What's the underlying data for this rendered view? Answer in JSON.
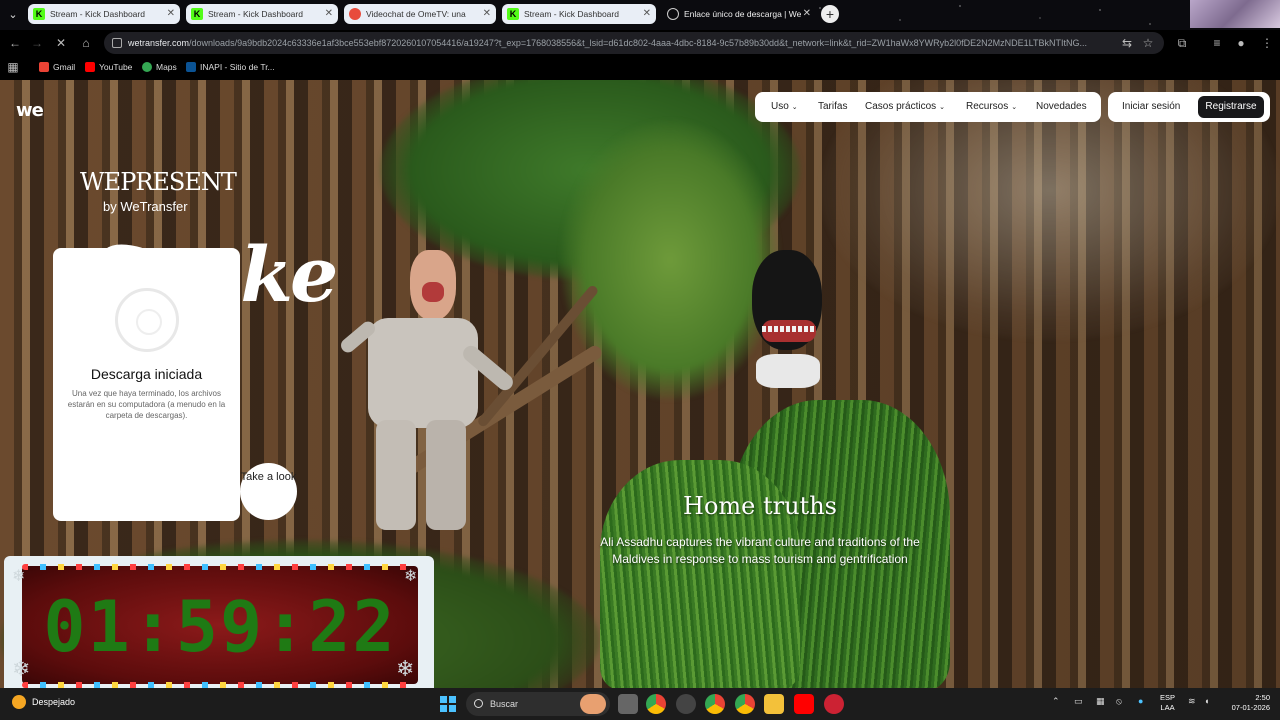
{
  "browser": {
    "tabs": [
      {
        "label": "Stream - Kick Dashboard",
        "favicon": "kick-icon",
        "active": false
      },
      {
        "label": "Stream - Kick Dashboard",
        "favicon": "kick-icon",
        "active": false
      },
      {
        "label": "Videochat de OmeTV: una",
        "favicon": "ometv-icon",
        "active": false
      },
      {
        "label": "Stream - Kick Dashboard",
        "favicon": "kick-icon",
        "active": false
      },
      {
        "label": "Enlace único de descarga | We",
        "favicon": "loading-icon",
        "active": true
      }
    ],
    "url_host": "wetransfer.com",
    "url_path": "/downloads/9a9bdb2024c63336e1af3bce553ebf8720260107054416/a19247?t_exp=1768038556&t_lsid=d61dc802-4aaa-4dbc-8184-9c57b89b30dd&t_network=link&t_rid=ZW1haWx8YWRyb2l0fDE2N2MzNDE1LTBkNTItNG...",
    "bookmarks": [
      {
        "label": "Gmail",
        "icon": "gmail-icon",
        "color": "#ea4335"
      },
      {
        "label": "YouTube",
        "icon": "youtube-icon",
        "color": "#ff0000"
      },
      {
        "label": "Maps",
        "icon": "maps-icon",
        "color": "#34a853"
      },
      {
        "label": "INAPI - Sitio de Tr...",
        "icon": "inapi-icon",
        "color": "#0b5394"
      }
    ]
  },
  "site": {
    "logo": "we",
    "nav": [
      {
        "label": "Uso",
        "dropdown": true
      },
      {
        "label": "Tarifas",
        "dropdown": false
      },
      {
        "label": "Casos prácticos",
        "dropdown": true
      },
      {
        "label": "Recursos",
        "dropdown": true
      },
      {
        "label": "Novedades",
        "dropdown": false
      }
    ],
    "login_label": "Iniciar sesión",
    "register_label": "Registrarse",
    "brand_title": "WEPRESENT",
    "brand_byline": "by WeTransfer",
    "script_title": "Snake",
    "download_panel": {
      "title": "Descarga iniciada",
      "text": "Una vez que haya terminado, los archivos estarán en su computadora (a menudo en la carpeta de descargas)."
    },
    "take_look_label": "Take a look",
    "hero_title": "Home truths",
    "hero_subtitle": "Ali Assadhu captures the vibrant culture and traditions of the Maldives in response to mass tourism and gentrification"
  },
  "overlay": {
    "timer": "01:59:22"
  },
  "taskbar": {
    "weather": "Despejado",
    "search_placeholder": "Buscar",
    "lang_top": "ESP",
    "lang_bottom": "LAA",
    "time": "2:50",
    "date": "07-01-2026"
  },
  "colors": {
    "kick_green": "#53fc18",
    "register_bg": "#18181a",
    "timer_digits": "#1f7a14",
    "timer_bg": "#8c1a1a"
  }
}
